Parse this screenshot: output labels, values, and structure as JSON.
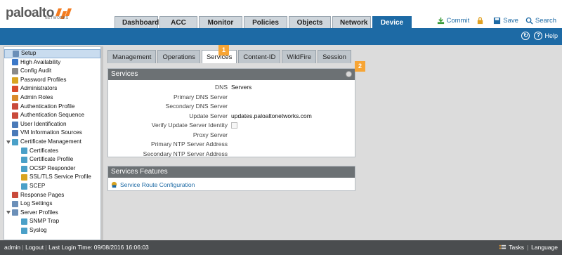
{
  "brand": {
    "name": "paloalto",
    "tagline": "NETWORKS"
  },
  "nav": {
    "tabs": [
      {
        "label": "Dashboard",
        "active": false
      },
      {
        "label": "ACC",
        "active": false
      },
      {
        "label": "Monitor",
        "active": false
      },
      {
        "label": "Policies",
        "active": false
      },
      {
        "label": "Objects",
        "active": false
      },
      {
        "label": "Network",
        "active": false
      },
      {
        "label": "Device",
        "active": true
      }
    ]
  },
  "toolbar": {
    "commit": "Commit",
    "save": "Save",
    "search": "Search",
    "help": "Help"
  },
  "sidebar": {
    "items": [
      {
        "label": "Setup",
        "icon": "setup-icon",
        "color": "#6b8fb8",
        "indent": 0,
        "selected": true
      },
      {
        "label": "High Availability",
        "icon": "ha-icon",
        "color": "#3c78c8",
        "indent": 0
      },
      {
        "label": "Config Audit",
        "icon": "audit-icon",
        "color": "#8a8a8a",
        "indent": 0
      },
      {
        "label": "Password Profiles",
        "icon": "password-icon",
        "color": "#d9a421",
        "indent": 0
      },
      {
        "label": "Administrators",
        "icon": "admin-icon",
        "color": "#d94a2b",
        "indent": 0
      },
      {
        "label": "Admin Roles",
        "icon": "roles-icon",
        "color": "#d98a2b",
        "indent": 0
      },
      {
        "label": "Authentication Profile",
        "icon": "auth-profile-icon",
        "color": "#c94a3b",
        "indent": 0
      },
      {
        "label": "Authentication Sequence",
        "icon": "auth-seq-icon",
        "color": "#c94a3b",
        "indent": 0
      },
      {
        "label": "User Identification",
        "icon": "user-id-icon",
        "color": "#4a7ab8",
        "indent": 0
      },
      {
        "label": "VM Information Sources",
        "icon": "vm-icon",
        "color": "#4a7ab8",
        "indent": 0
      },
      {
        "label": "Certificate Management",
        "icon": "cert-mgmt-icon",
        "color": "#4aa0c8",
        "indent": 0,
        "expanded": true
      },
      {
        "label": "Certificates",
        "icon": "certificate-icon",
        "color": "#4aa0c8",
        "indent": 1
      },
      {
        "label": "Certificate Profile",
        "icon": "cert-profile-icon",
        "color": "#4aa0c8",
        "indent": 1
      },
      {
        "label": "OCSP Responder",
        "icon": "ocsp-icon",
        "color": "#4aa0c8",
        "indent": 1
      },
      {
        "label": "SSL/TLS Service Profile",
        "icon": "ssl-icon",
        "color": "#d9a421",
        "indent": 1
      },
      {
        "label": "SCEP",
        "icon": "scep-icon",
        "color": "#4aa0c8",
        "indent": 1
      },
      {
        "label": "Response Pages",
        "icon": "response-icon",
        "color": "#c94a3b",
        "indent": 0
      },
      {
        "label": "Log Settings",
        "icon": "log-icon",
        "color": "#6b8fb8",
        "indent": 0
      },
      {
        "label": "Server Profiles",
        "icon": "server-profiles-icon",
        "color": "#6b8fb8",
        "indent": 0,
        "expanded": true
      },
      {
        "label": "SNMP Trap",
        "icon": "snmp-icon",
        "color": "#4aa0c8",
        "indent": 1
      },
      {
        "label": "Syslog",
        "icon": "syslog-icon",
        "color": "#4aa0c8",
        "indent": 1
      }
    ]
  },
  "subtabs": [
    {
      "label": "Management",
      "active": false
    },
    {
      "label": "Operations",
      "active": false
    },
    {
      "label": "Services",
      "active": true
    },
    {
      "label": "Content-ID",
      "active": false
    },
    {
      "label": "WildFire",
      "active": false
    },
    {
      "label": "Session",
      "active": false
    }
  ],
  "services": {
    "title": "Services",
    "rows": [
      {
        "label": "DNS",
        "value": "Servers"
      },
      {
        "label": "Primary DNS Server",
        "value": ""
      },
      {
        "label": "Secondary DNS Server",
        "value": ""
      },
      {
        "label": "Update Server",
        "value": "updates.paloaltonetworks.com"
      },
      {
        "label": "Verify Update Server Identity",
        "value": "",
        "checkbox": true
      },
      {
        "label": "Proxy Server",
        "value": ""
      },
      {
        "label": "Primary NTP Server Address",
        "value": ""
      },
      {
        "label": "Secondary NTP Server Address",
        "value": ""
      }
    ]
  },
  "features": {
    "title": "Services Features",
    "link": "Service Route Configuration"
  },
  "callouts": [
    "1",
    "2"
  ],
  "status": {
    "user": "admin",
    "logout": "Logout",
    "last_login": "Last Login Time: 09/08/2016 16:06:03",
    "tasks": "Tasks",
    "language": "Language"
  }
}
